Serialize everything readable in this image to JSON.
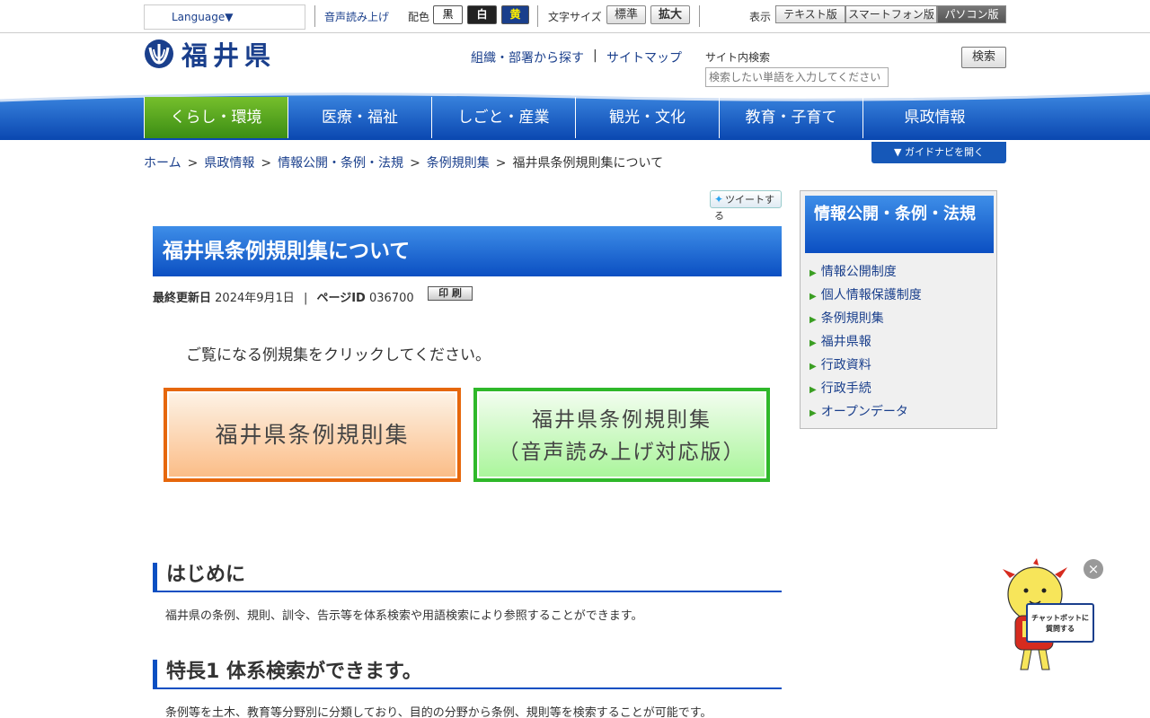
{
  "util": {
    "language": "Language▼",
    "voice": "音声読み上げ",
    "color_label": "配色",
    "colors": [
      {
        "label": "黒",
        "bg": "#ffffff",
        "fg": "#000000"
      },
      {
        "label": "白",
        "bg": "#222222",
        "fg": "#ffffff"
      },
      {
        "label": "黄",
        "bg": "#1a3f8c",
        "fg": "#ffee00"
      }
    ],
    "fontsize_label": "文字サイズ",
    "font_standard": "標準",
    "font_large": "拡大",
    "display_label": "表示",
    "display_text": "テキスト版",
    "display_smartphone": "スマートフォン版",
    "display_pc": "パソコン版"
  },
  "header": {
    "logo_text": "福井県",
    "link_org": "組織・部署から探す",
    "link_sitemap": "サイトマップ",
    "search_label": "サイト内検索",
    "search_placeholder": "検索したい単語を入力してください",
    "search_button": "検索"
  },
  "nav": {
    "items": [
      "くらし・環境",
      "医療・福祉",
      "しごと・産業",
      "観光・文化",
      "教育・子育て",
      "県政情報"
    ]
  },
  "guide_button": "▼ ガイドナビを開く",
  "breadcrumb": [
    "ホーム",
    "県政情報",
    "情報公開・条例・法規",
    "条例規則集",
    "福井県条例規則集について"
  ],
  "tweet": "ツイートする",
  "page": {
    "title": "福井県条例規則集について",
    "updated_label": "最終更新日",
    "updated_value": "2024年9月1日",
    "pageid_label": "ページID",
    "pageid_value": "036700",
    "print": "印 刷",
    "intro": "ご覧になる例規集をクリックしてください。",
    "btn_orange": "福井県条例規則集",
    "btn_green_line1": "福井県条例規則集",
    "btn_green_line2": "（音声読み上げ対応版）",
    "sections": [
      {
        "heading": "はじめに",
        "text": "福井県の条例、規則、訓令、告示等を体系検索や用語検索により参照することができます。"
      },
      {
        "heading": "特長1 体系検索ができます。",
        "text": "条例等を土木、教育等分野別に分類しており、目的の分野から条例、規則等を検索することが可能です。"
      }
    ]
  },
  "sidebar": {
    "title": "情報公開・条例・法規",
    "items": [
      "情報公開制度",
      "個人情報保護制度",
      "条例規則集",
      "福井県報",
      "行政資料",
      "行政手続",
      "オープンデータ"
    ]
  },
  "chat": {
    "close": "×",
    "sign_line1": "チャットボットに",
    "sign_line2": "質問する"
  }
}
